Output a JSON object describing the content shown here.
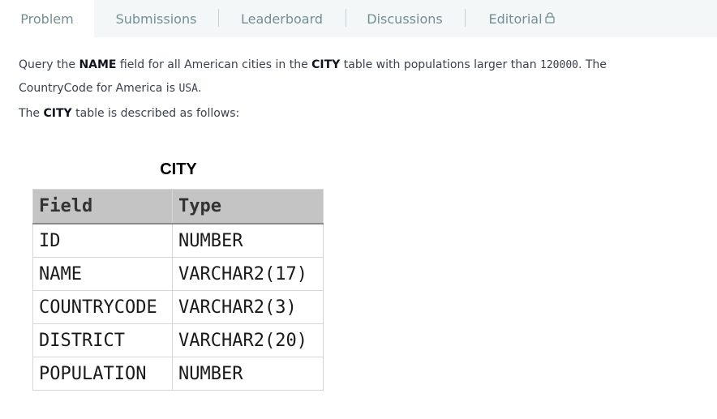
{
  "tabs": [
    {
      "label": "Problem",
      "active": true
    },
    {
      "label": "Submissions",
      "active": false
    },
    {
      "label": "Leaderboard",
      "active": false
    },
    {
      "label": "Discussions",
      "active": false
    },
    {
      "label": "Editorial",
      "active": false,
      "icon": "lock-icon"
    }
  ],
  "statement": {
    "p1_a": "Query the ",
    "p1_b": "NAME",
    "p1_c": " field for all American cities in the ",
    "p1_d": "CITY",
    "p1_e": " table with populations larger than ",
    "p1_f": "120000",
    "p1_g": ". The CountryCode for America is ",
    "p1_h": "USA",
    "p1_i": ".",
    "p2_a": "The ",
    "p2_b": "CITY",
    "p2_c": " table is described as follows:"
  },
  "table": {
    "caption": "CITY",
    "headers": [
      "Field",
      "Type"
    ],
    "rows": [
      [
        "ID",
        "NUMBER"
      ],
      [
        "NAME",
        "VARCHAR2(17)"
      ],
      [
        "COUNTRYCODE",
        "VARCHAR2(3)"
      ],
      [
        "DISTRICT",
        "VARCHAR2(20)"
      ],
      [
        "POPULATION",
        "NUMBER"
      ]
    ]
  },
  "colors": {
    "tab_bar_bg": "#f3f7f7",
    "tab_text": "#738f93",
    "body_text": "#39424e",
    "table_header_bg": "#c4c4c4"
  }
}
